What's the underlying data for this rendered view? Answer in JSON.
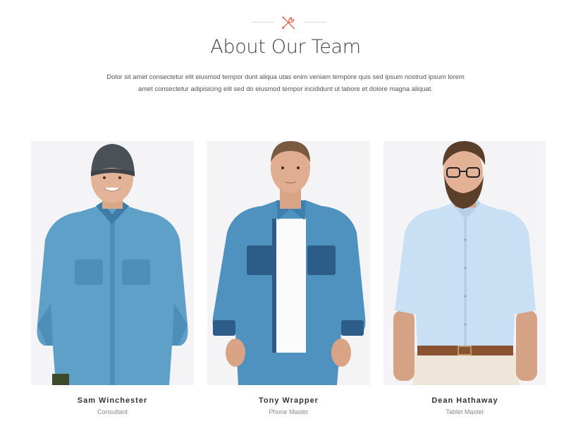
{
  "section": {
    "icon": "tools-icon",
    "title": "About Our Team",
    "description_line1": "Dolor sit amet consectetur elit eiusmod tempor dunt aliqua utas enim veniam tempore quis sed ipsum nostrud ipsum lorem",
    "description_line2": "amet consectetur adipisicing elit sed do eiusmod tempor incididunt ut labore et dolore magna aliquat."
  },
  "accent_color": "#e8644f",
  "team": [
    {
      "name": "Sam Winchester",
      "role": "Consultant"
    },
    {
      "name": "Tony Wrapper",
      "role": "Phone Master"
    },
    {
      "name": "Dean Hathaway",
      "role": "Tablet Master"
    }
  ]
}
